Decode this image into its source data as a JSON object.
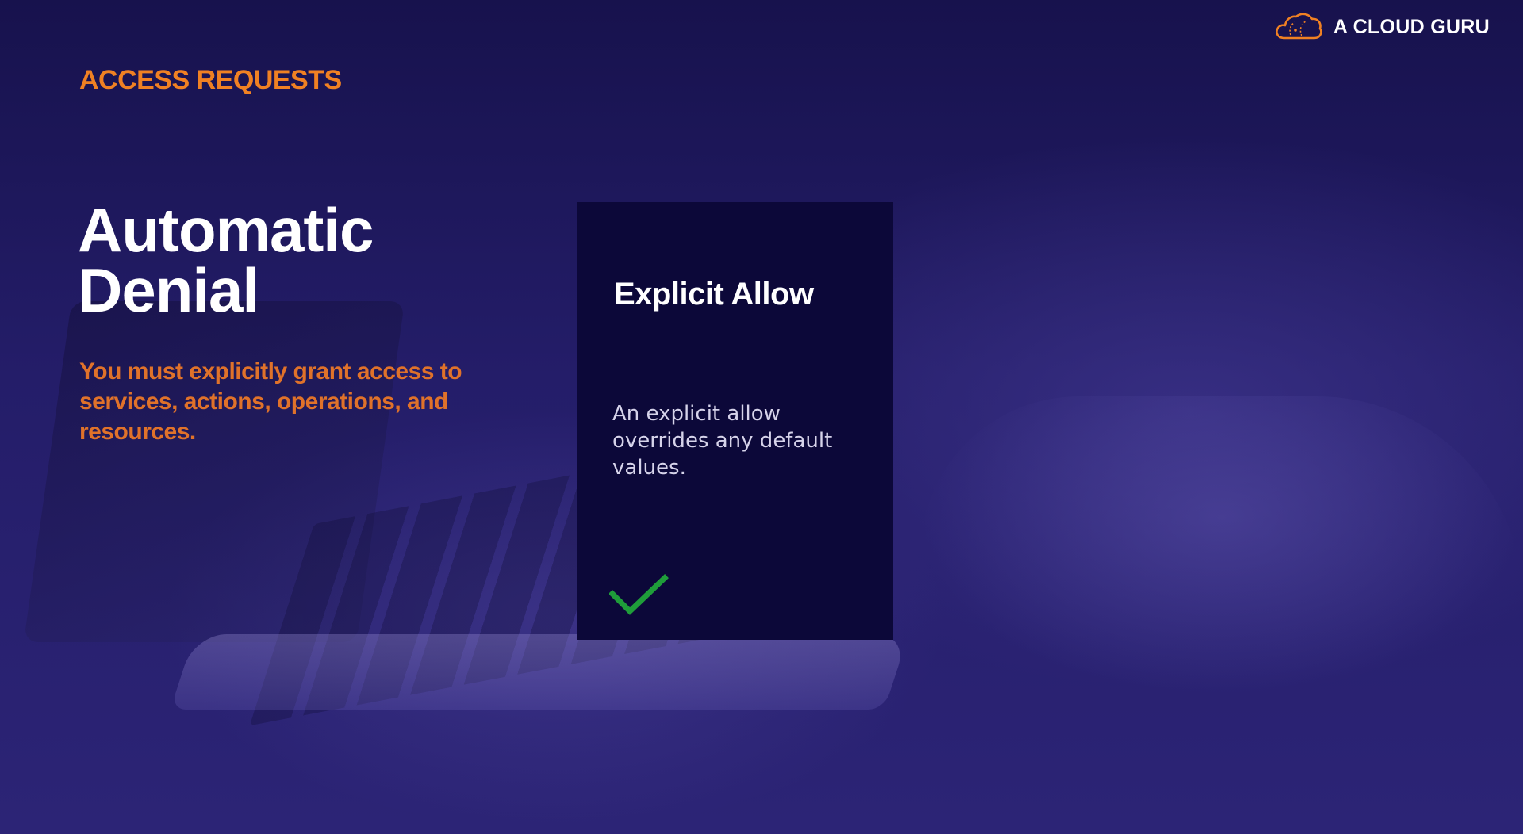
{
  "brand": {
    "name": "A CLOUD GURU",
    "icon": "cloud-logo-icon",
    "accent": "#f08123"
  },
  "slide": {
    "section_label": "ACCESS REQUESTS",
    "title_line1": "Automatic",
    "title_line2": "Denial",
    "subtitle": "You must explicitly grant access to services, actions, operations, and resources."
  },
  "card": {
    "title": "Explicit Allow",
    "body": "An explicit allow overrides any default values.",
    "status_icon": "checkmark-icon",
    "status_color": "#1f9d3a"
  }
}
